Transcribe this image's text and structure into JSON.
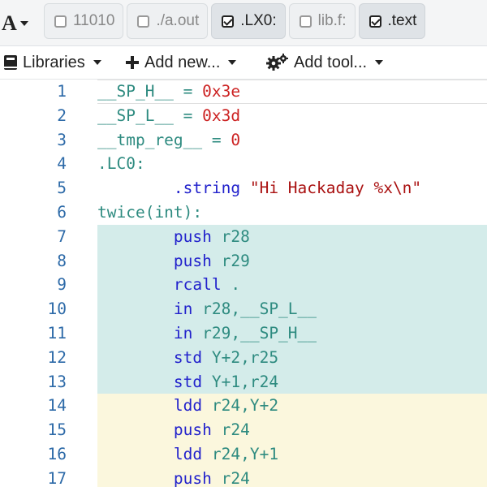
{
  "header": {
    "font_button_label": "A",
    "filters": [
      {
        "label": "11010",
        "checked": false
      },
      {
        "label": "./a.out",
        "checked": false
      },
      {
        "label": ".LX0:",
        "checked": true
      },
      {
        "label": "lib.f:",
        "checked": false
      },
      {
        "label": ".text",
        "checked": true
      }
    ]
  },
  "toolbar": {
    "libraries_label": "Libraries",
    "add_new_label": "Add new...",
    "add_tool_label": "Add tool..."
  },
  "editor": {
    "lines": [
      {
        "num": "1",
        "highlight": "none",
        "tokens": [
          {
            "t": "__SP_H__",
            "c": "lbl"
          },
          {
            "t": " = ",
            "c": "op"
          },
          {
            "t": "0x3e",
            "c": "num"
          }
        ]
      },
      {
        "num": "2",
        "highlight": "none",
        "tokens": [
          {
            "t": "__SP_L__",
            "c": "lbl"
          },
          {
            "t": " = ",
            "c": "op"
          },
          {
            "t": "0x3d",
            "c": "num"
          }
        ]
      },
      {
        "num": "3",
        "highlight": "none",
        "tokens": [
          {
            "t": "__tmp_reg__",
            "c": "lbl"
          },
          {
            "t": " = ",
            "c": "op"
          },
          {
            "t": "0",
            "c": "num"
          }
        ]
      },
      {
        "num": "4",
        "highlight": "none",
        "tokens": [
          {
            "t": ".LC0:",
            "c": "lbl"
          }
        ]
      },
      {
        "num": "5",
        "highlight": "none",
        "tokens": [
          {
            "t": "        .string ",
            "c": "dir"
          },
          {
            "t": "\"Hi Hackaday %x\\n\"",
            "c": "str"
          }
        ]
      },
      {
        "num": "6",
        "highlight": "none",
        "tokens": [
          {
            "t": "twice(int):",
            "c": "lbl"
          }
        ]
      },
      {
        "num": "7",
        "highlight": "teal",
        "tokens": [
          {
            "t": "        push ",
            "c": "ins"
          },
          {
            "t": "r28",
            "c": "arg"
          }
        ]
      },
      {
        "num": "8",
        "highlight": "teal",
        "tokens": [
          {
            "t": "        push ",
            "c": "ins"
          },
          {
            "t": "r29",
            "c": "arg"
          }
        ]
      },
      {
        "num": "9",
        "highlight": "teal",
        "tokens": [
          {
            "t": "        rcall ",
            "c": "ins"
          },
          {
            "t": ".",
            "c": "arg"
          }
        ]
      },
      {
        "num": "10",
        "highlight": "teal",
        "tokens": [
          {
            "t": "        in ",
            "c": "ins"
          },
          {
            "t": "r28,__SP_L__",
            "c": "arg"
          }
        ]
      },
      {
        "num": "11",
        "highlight": "teal",
        "tokens": [
          {
            "t": "        in ",
            "c": "ins"
          },
          {
            "t": "r29,__SP_H__",
            "c": "arg"
          }
        ]
      },
      {
        "num": "12",
        "highlight": "teal",
        "tokens": [
          {
            "t": "        std ",
            "c": "ins"
          },
          {
            "t": "Y+2,r25",
            "c": "arg"
          }
        ]
      },
      {
        "num": "13",
        "highlight": "teal",
        "tokens": [
          {
            "t": "        std ",
            "c": "ins"
          },
          {
            "t": "Y+1,r24",
            "c": "arg"
          }
        ]
      },
      {
        "num": "14",
        "highlight": "yellow",
        "tokens": [
          {
            "t": "        ldd ",
            "c": "ins"
          },
          {
            "t": "r24,Y+2",
            "c": "arg"
          }
        ]
      },
      {
        "num": "15",
        "highlight": "yellow",
        "tokens": [
          {
            "t": "        push ",
            "c": "ins"
          },
          {
            "t": "r24",
            "c": "arg"
          }
        ]
      },
      {
        "num": "16",
        "highlight": "yellow",
        "tokens": [
          {
            "t": "        ldd ",
            "c": "ins"
          },
          {
            "t": "r24,Y+1",
            "c": "arg"
          }
        ]
      },
      {
        "num": "17",
        "highlight": "yellow",
        "tokens": [
          {
            "t": "        push ",
            "c": "ins"
          },
          {
            "t": "r24",
            "c": "arg"
          }
        ]
      }
    ]
  },
  "icons": {
    "libraries": "book-icon",
    "add_new": "plus-icon",
    "add_tool": "cogs-icon",
    "checkbox": "checkbox-icon"
  },
  "colors": {
    "highlight_teal": "#d4ecea",
    "highlight_yellow": "#fbf7dd",
    "line_number": "#2d6aa8",
    "label": "#2e8b80",
    "number": "#cc2222",
    "instruction": "#2222cc",
    "string": "#aa1111"
  }
}
